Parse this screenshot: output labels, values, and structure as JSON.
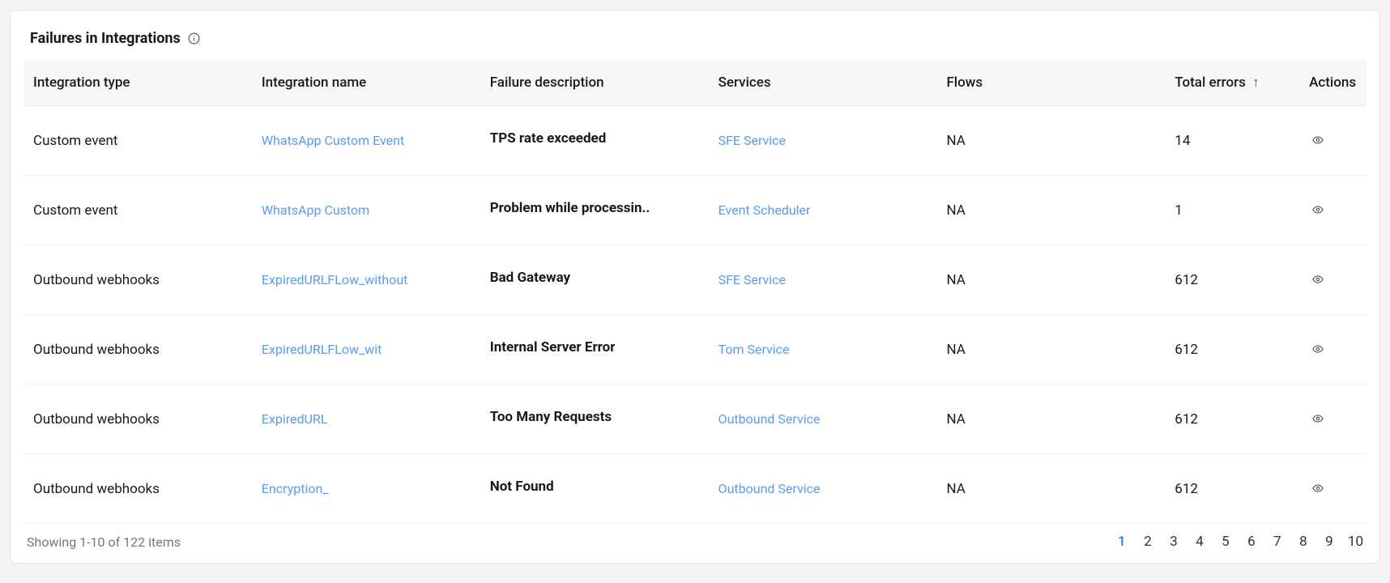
{
  "header": {
    "title": "Failures in Integrations"
  },
  "columns": {
    "integration_type": "Integration type",
    "integration_name": "Integration name",
    "failure_description": "Failure description",
    "services": "Services",
    "flows": "Flows",
    "total_errors": "Total errors",
    "actions": "Actions"
  },
  "sort": {
    "column": "total_errors",
    "direction": "asc",
    "glyph": "↑"
  },
  "rows": [
    {
      "integration_type": "Custom event",
      "integration_name": "WhatsApp Custom Event",
      "failure_description": "TPS rate exceeded",
      "service": "SFE Service",
      "flows": "NA",
      "total_errors": "14"
    },
    {
      "integration_type": "Custom event",
      "integration_name": "WhatsApp Custom",
      "failure_description": "Problem while processin..",
      "service": "Event Scheduler",
      "flows": "NA",
      "total_errors": "1"
    },
    {
      "integration_type": "Outbound webhooks",
      "integration_name": "ExpiredURLFLow_without",
      "failure_description": "Bad Gateway",
      "service": "SFE Service",
      "flows": "NA",
      "total_errors": "612"
    },
    {
      "integration_type": "Outbound webhooks",
      "integration_name": "ExpiredURLFLow_wit",
      "failure_description": "Internal Server Error",
      "service": "Tom Service",
      "flows": "NA",
      "total_errors": "612"
    },
    {
      "integration_type": "Outbound webhooks",
      "integration_name": "ExpiredURL",
      "failure_description": "Too Many Requests",
      "service": "Outbound  Service",
      "flows": "NA",
      "total_errors": "612"
    },
    {
      "integration_type": "Outbound webhooks",
      "integration_name": "Encryption_",
      "failure_description": "Not Found",
      "service": "Outbound Service",
      "flows": "NA",
      "total_errors": "612"
    }
  ],
  "footer": {
    "summary": "Showing 1-10 of 122 items",
    "pages": [
      "1",
      "2",
      "3",
      "4",
      "5",
      "6",
      "7",
      "8",
      "9",
      "10"
    ],
    "current_page": "1"
  }
}
